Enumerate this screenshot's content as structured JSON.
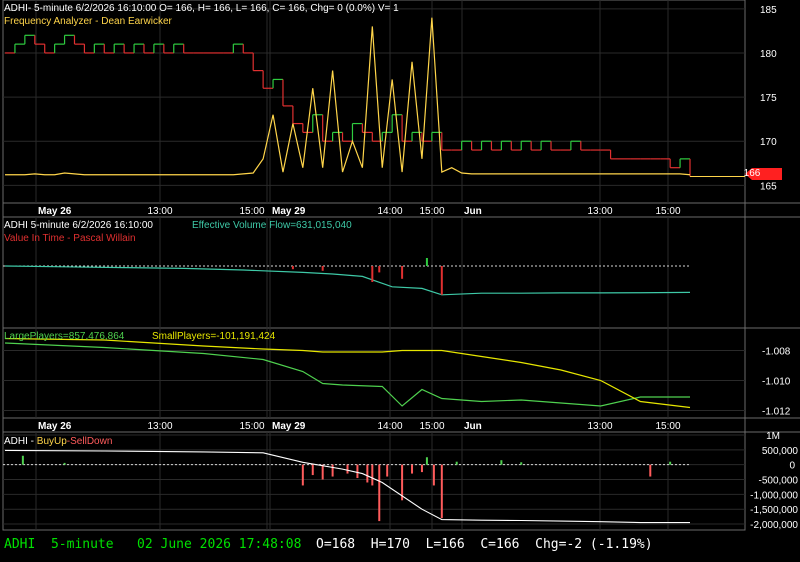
{
  "symbol": "ADHI",
  "colors": {
    "background": "#000000",
    "grid": "#2a2a2a",
    "border": "#6a6a6a",
    "price_up": "#2ecc40",
    "price_down": "#e03030",
    "frequency": "#ffd54a",
    "effective_volume_flow": "#3ec9a7",
    "value_in_time": "#e03030",
    "large_players": "#4fd14f",
    "small_players": "#e6e600",
    "buy_up": "#4fd14f",
    "sell_down": "#ff5c5c",
    "status_green": "#00e000",
    "last_price_tag": "#ff2020"
  },
  "panel1": {
    "header": "ADHI- 5-minute 6/2/2026 16:10:00 O= 166, H= 166, L= 166, C= 166, Chg= 0 (0.0%) V= 1",
    "subheader": "Frequency Analyzer - Dean Earwicker",
    "last_price_tag": "166"
  },
  "panel2": {
    "header_left": "ADHI 5-minute  6/2/2026 16:10:00",
    "header_right": "Effective Volume Flow=631,015,040",
    "subheader": "Value In Time - Pascal Willain"
  },
  "panel3": {
    "large_label": "LargePlayers=857,476,864",
    "small_label": "SmallPlayers=-101,191,424"
  },
  "panel4": {
    "prefix": "ADHI - ",
    "buy_label": "BuyUp",
    "dash": "-",
    "sell_label": "SellDown"
  },
  "time_axis": [
    "May 26",
    "13:00",
    "15:00",
    "May 29",
    "14:00",
    "15:00",
    "Jun",
    "13:00",
    "15:00"
  ],
  "status_bar": {
    "left": "ADHI  5-minute   02 June 2026 17:48:08",
    "right": "O=168  H=170  L=166  C=166  Chg=-2 (-1.19%)"
  },
  "chart_data": [
    {
      "type": "line",
      "name": "price",
      "y_axis_ticks": [
        165,
        170,
        175,
        180,
        185
      ],
      "ylim": [
        163,
        186
      ],
      "x": [
        0,
        10,
        20,
        30,
        40,
        50,
        60,
        70,
        80,
        90,
        100,
        110,
        120,
        130,
        140,
        150,
        160,
        170,
        180,
        190,
        200,
        210,
        220,
        230,
        240,
        250,
        260,
        270,
        280,
        290,
        300,
        310,
        320,
        330,
        340,
        350,
        360,
        370,
        380,
        390,
        400,
        410,
        420,
        430,
        440,
        450,
        460,
        470,
        480,
        490,
        500,
        510,
        520,
        530,
        540,
        550,
        560,
        570,
        580,
        590,
        600,
        610,
        620,
        630,
        640,
        650,
        660,
        670,
        680,
        690
      ],
      "price": [
        180,
        181,
        182,
        181,
        180,
        181,
        182,
        181,
        180,
        181,
        180,
        181,
        180,
        181,
        180,
        181,
        180,
        181,
        180,
        180,
        180,
        180,
        180,
        181,
        180,
        178,
        176,
        177,
        174,
        172,
        171,
        173,
        170,
        171,
        170,
        172,
        171,
        170,
        171,
        173,
        170,
        171,
        170,
        171,
        169,
        169,
        170,
        169,
        170,
        169,
        170,
        169,
        170,
        169,
        170,
        169,
        169,
        170,
        169,
        169,
        169,
        168,
        168,
        168,
        168,
        168,
        168,
        167,
        168,
        166
      ],
      "frequency": [
        166.2,
        166.2,
        166.2,
        166.3,
        166.2,
        166.2,
        166.4,
        166.3,
        166.2,
        166.2,
        166.2,
        166.2,
        166.2,
        166.2,
        166.2,
        166.2,
        166.2,
        166.2,
        166.2,
        166.2,
        166.2,
        166.2,
        166.2,
        166.2,
        166.3,
        166.4,
        168,
        173,
        166.5,
        172,
        167,
        176,
        167,
        178,
        166.5,
        170,
        167,
        183,
        167,
        177,
        166.5,
        179,
        168,
        184,
        166.5,
        167,
        166.4,
        166.3,
        166.3,
        166.3,
        166.3,
        166.3,
        166.3,
        166.3,
        166.3,
        166.3,
        166.3,
        166.3,
        166.3,
        166.3,
        166.3,
        166.3,
        166.3,
        166.3,
        166.3,
        166.3,
        166.3,
        166.3,
        166.3,
        166.2
      ]
    },
    {
      "type": "line",
      "name": "effective_volume_flow",
      "x": [
        0,
        60,
        120,
        180,
        240,
        300,
        330,
        360,
        390,
        420,
        440,
        480,
        520,
        560,
        600,
        640,
        690
      ],
      "effective_volume_flow": [
        0,
        -0.5,
        -1,
        -1.5,
        -2.5,
        -4,
        -5,
        -6.5,
        -13,
        -14,
        -18,
        -17,
        -17,
        -16.8,
        -16.8,
        -16.7,
        -16.5
      ],
      "value_in_time_spikes": [
        {
          "x": 370,
          "v": -10
        },
        {
          "x": 377,
          "v": -4
        },
        {
          "x": 400,
          "v": -8
        },
        {
          "x": 440,
          "v": -18
        },
        {
          "x": 425,
          "v": 5
        },
        {
          "x": 320,
          "v": -3
        },
        {
          "x": 290,
          "v": -2
        }
      ]
    },
    {
      "type": "line",
      "name": "large_small_players",
      "y_axis_ticks": [
        -1.008,
        -1.01,
        -1.012
      ],
      "ylim": [
        -1.0125,
        -1.0065
      ],
      "x": [
        0,
        100,
        200,
        260,
        300,
        320,
        340,
        380,
        400,
        420,
        440,
        480,
        520,
        560,
        600,
        640,
        690
      ],
      "large_players": [
        -1.0075,
        -1.0078,
        -1.0082,
        -1.0086,
        -1.0094,
        -1.0102,
        -1.0103,
        -1.0104,
        -1.0117,
        -1.0106,
        -1.0112,
        -1.0114,
        -1.0113,
        -1.0115,
        -1.0117,
        -1.0111,
        -1.0111
      ],
      "small_players": [
        -1.0072,
        -1.0073,
        -1.0077,
        -1.0079,
        -1.008,
        -1.0081,
        -1.0081,
        -1.0081,
        -1.008,
        -1.008,
        -1.008,
        -1.0084,
        -1.0088,
        -1.0093,
        -1.01,
        -1.0114,
        -1.0118
      ]
    },
    {
      "type": "bar",
      "name": "buyup_selldown",
      "y_axis_ticks": [
        "1M",
        "500,000",
        "0",
        "-500,000",
        "-1,000,000",
        "-1,500,000",
        "-2,000,000"
      ],
      "ylim": [
        -2200000,
        1100000
      ],
      "line_x": [
        0,
        100,
        200,
        260,
        300,
        340,
        360,
        380,
        420,
        440,
        480,
        520,
        560,
        600,
        640,
        690
      ],
      "line": [
        480000,
        460000,
        430000,
        400000,
        80000,
        -150000,
        -300000,
        -600000,
        -1500000,
        -1850000,
        -1870000,
        -1880000,
        -1900000,
        -1920000,
        -1950000,
        -1950000
      ],
      "bars": [
        {
          "x": 18,
          "v": 300000
        },
        {
          "x": 60,
          "v": 60000
        },
        {
          "x": 300,
          "v": -700000
        },
        {
          "x": 310,
          "v": -350000
        },
        {
          "x": 320,
          "v": -500000
        },
        {
          "x": 330,
          "v": -400000
        },
        {
          "x": 345,
          "v": -300000
        },
        {
          "x": 355,
          "v": -450000
        },
        {
          "x": 365,
          "v": -600000
        },
        {
          "x": 370,
          "v": -700000
        },
        {
          "x": 377,
          "v": -1900000
        },
        {
          "x": 385,
          "v": -400000
        },
        {
          "x": 400,
          "v": -1200000
        },
        {
          "x": 410,
          "v": -300000
        },
        {
          "x": 420,
          "v": -250000
        },
        {
          "x": 425,
          "v": 250000
        },
        {
          "x": 432,
          "v": -700000
        },
        {
          "x": 440,
          "v": -1800000
        },
        {
          "x": 455,
          "v": 100000
        },
        {
          "x": 500,
          "v": 150000
        },
        {
          "x": 520,
          "v": 80000
        },
        {
          "x": 650,
          "v": -400000
        },
        {
          "x": 670,
          "v": 100000
        }
      ]
    }
  ]
}
